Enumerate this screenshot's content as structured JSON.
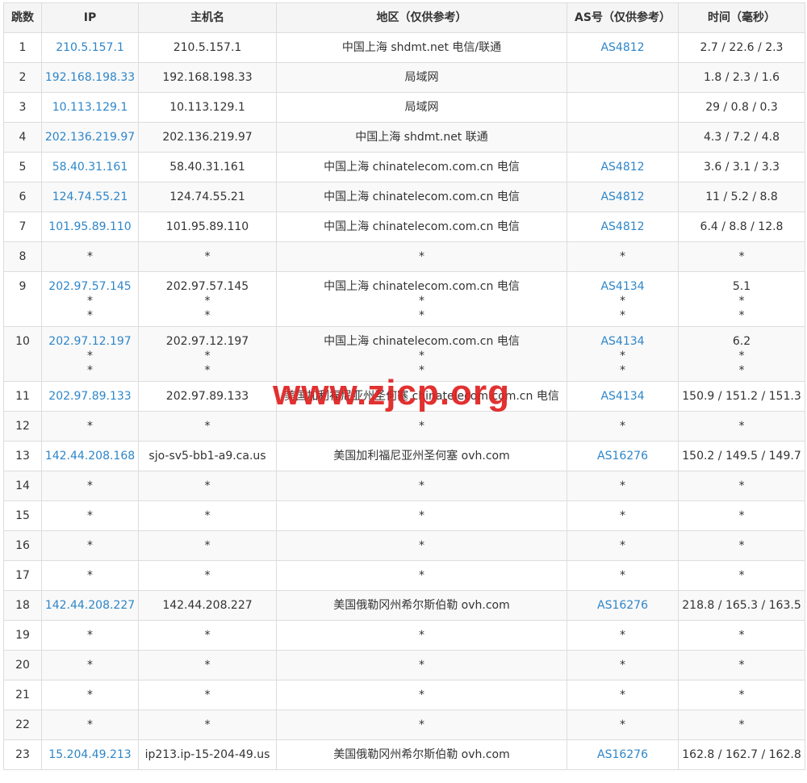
{
  "headers": [
    "跳数",
    "IP",
    "主机名",
    "地区（仅供参考）",
    "AS号（仅供参考）",
    "时间（毫秒）"
  ],
  "rows": [
    {
      "hop": "1",
      "ip": [
        "210.5.157.1"
      ],
      "host": [
        "210.5.157.1"
      ],
      "region": [
        "中国上海 shdmt.net 电信/联通"
      ],
      "as": [
        "AS4812"
      ],
      "time": [
        "2.7 / 22.6 / 2.3"
      ]
    },
    {
      "hop": "2",
      "ip": [
        "192.168.198.33"
      ],
      "host": [
        "192.168.198.33"
      ],
      "region": [
        "局域网"
      ],
      "as": [
        ""
      ],
      "time": [
        "1.8 / 2.3 / 1.6"
      ]
    },
    {
      "hop": "3",
      "ip": [
        "10.113.129.1"
      ],
      "host": [
        "10.113.129.1"
      ],
      "region": [
        "局域网"
      ],
      "as": [
        ""
      ],
      "time": [
        "29 / 0.8 / 0.3"
      ]
    },
    {
      "hop": "4",
      "ip": [
        "202.136.219.97"
      ],
      "host": [
        "202.136.219.97"
      ],
      "region": [
        "中国上海 shdmt.net 联通"
      ],
      "as": [
        ""
      ],
      "time": [
        "4.3 / 7.2 / 4.8"
      ]
    },
    {
      "hop": "5",
      "ip": [
        "58.40.31.161"
      ],
      "host": [
        "58.40.31.161"
      ],
      "region": [
        "中国上海 chinatelecom.com.cn 电信"
      ],
      "as": [
        "AS4812"
      ],
      "time": [
        "3.6 / 3.1 / 3.3"
      ]
    },
    {
      "hop": "6",
      "ip": [
        "124.74.55.21"
      ],
      "host": [
        "124.74.55.21"
      ],
      "region": [
        "中国上海 chinatelecom.com.cn 电信"
      ],
      "as": [
        "AS4812"
      ],
      "time": [
        "11 / 5.2 / 8.8"
      ]
    },
    {
      "hop": "7",
      "ip": [
        "101.95.89.110"
      ],
      "host": [
        "101.95.89.110"
      ],
      "region": [
        "中国上海 chinatelecom.com.cn 电信"
      ],
      "as": [
        "AS4812"
      ],
      "time": [
        "6.4 / 8.8 / 12.8"
      ]
    },
    {
      "hop": "8",
      "ip": [
        "*"
      ],
      "host": [
        "*"
      ],
      "region": [
        "*"
      ],
      "as": [
        "*"
      ],
      "time": [
        "*"
      ]
    },
    {
      "hop": "9",
      "ip": [
        "202.97.57.145",
        "*",
        "*"
      ],
      "host": [
        "202.97.57.145",
        "*",
        "*"
      ],
      "region": [
        "中国上海 chinatelecom.com.cn 电信",
        "*",
        "*"
      ],
      "as": [
        "AS4134",
        "*",
        "*"
      ],
      "time": [
        "5.1",
        "*",
        "*"
      ]
    },
    {
      "hop": "10",
      "ip": [
        "202.97.12.197",
        "*",
        "*"
      ],
      "host": [
        "202.97.12.197",
        "*",
        "*"
      ],
      "region": [
        "中国上海 chinatelecom.com.cn 电信",
        "*",
        "*"
      ],
      "as": [
        "AS4134",
        "*",
        "*"
      ],
      "time": [
        "6.2",
        "*",
        "*"
      ]
    },
    {
      "hop": "11",
      "ip": [
        "202.97.89.133"
      ],
      "host": [
        "202.97.89.133"
      ],
      "region": [
        "美国加利福尼亚州圣何塞 chinatelecom.com.cn 电信"
      ],
      "as": [
        "AS4134"
      ],
      "time": [
        "150.9 / 151.2 / 151.3"
      ]
    },
    {
      "hop": "12",
      "ip": [
        "*"
      ],
      "host": [
        "*"
      ],
      "region": [
        "*"
      ],
      "as": [
        "*"
      ],
      "time": [
        "*"
      ]
    },
    {
      "hop": "13",
      "ip": [
        "142.44.208.168"
      ],
      "host": [
        "sjo-sv5-bb1-a9.ca.us"
      ],
      "region": [
        "美国加利福尼亚州圣何塞 ovh.com"
      ],
      "as": [
        "AS16276"
      ],
      "time": [
        "150.2 / 149.5 / 149.7"
      ]
    },
    {
      "hop": "14",
      "ip": [
        "*"
      ],
      "host": [
        "*"
      ],
      "region": [
        "*"
      ],
      "as": [
        "*"
      ],
      "time": [
        "*"
      ]
    },
    {
      "hop": "15",
      "ip": [
        "*"
      ],
      "host": [
        "*"
      ],
      "region": [
        "*"
      ],
      "as": [
        "*"
      ],
      "time": [
        "*"
      ]
    },
    {
      "hop": "16",
      "ip": [
        "*"
      ],
      "host": [
        "*"
      ],
      "region": [
        "*"
      ],
      "as": [
        "*"
      ],
      "time": [
        "*"
      ]
    },
    {
      "hop": "17",
      "ip": [
        "*"
      ],
      "host": [
        "*"
      ],
      "region": [
        "*"
      ],
      "as": [
        "*"
      ],
      "time": [
        "*"
      ]
    },
    {
      "hop": "18",
      "ip": [
        "142.44.208.227"
      ],
      "host": [
        "142.44.208.227"
      ],
      "region": [
        "美国俄勒冈州希尔斯伯勒 ovh.com"
      ],
      "as": [
        "AS16276"
      ],
      "time": [
        "218.8 / 165.3 / 163.5"
      ]
    },
    {
      "hop": "19",
      "ip": [
        "*"
      ],
      "host": [
        "*"
      ],
      "region": [
        "*"
      ],
      "as": [
        "*"
      ],
      "time": [
        "*"
      ]
    },
    {
      "hop": "20",
      "ip": [
        "*"
      ],
      "host": [
        "*"
      ],
      "region": [
        "*"
      ],
      "as": [
        "*"
      ],
      "time": [
        "*"
      ]
    },
    {
      "hop": "21",
      "ip": [
        "*"
      ],
      "host": [
        "*"
      ],
      "region": [
        "*"
      ],
      "as": [
        "*"
      ],
      "time": [
        "*"
      ]
    },
    {
      "hop": "22",
      "ip": [
        "*"
      ],
      "host": [
        "*"
      ],
      "region": [
        "*"
      ],
      "as": [
        "*"
      ],
      "time": [
        "*"
      ]
    },
    {
      "hop": "23",
      "ip": [
        "15.204.49.213"
      ],
      "host": [
        "ip213.ip-15-204-49.us"
      ],
      "region": [
        "美国俄勒冈州希尔斯伯勒 ovh.com"
      ],
      "as": [
        "AS16276"
      ],
      "time": [
        "162.8 / 162.7 / 162.8"
      ]
    }
  ],
  "watermark": "www.zjcp.org",
  "colors": {
    "link": "#2e86c9",
    "header_bg": "#f5f5f5",
    "stripe_bg": "#f9f9f9",
    "border": "#dddddd",
    "watermark": "#e02020"
  }
}
